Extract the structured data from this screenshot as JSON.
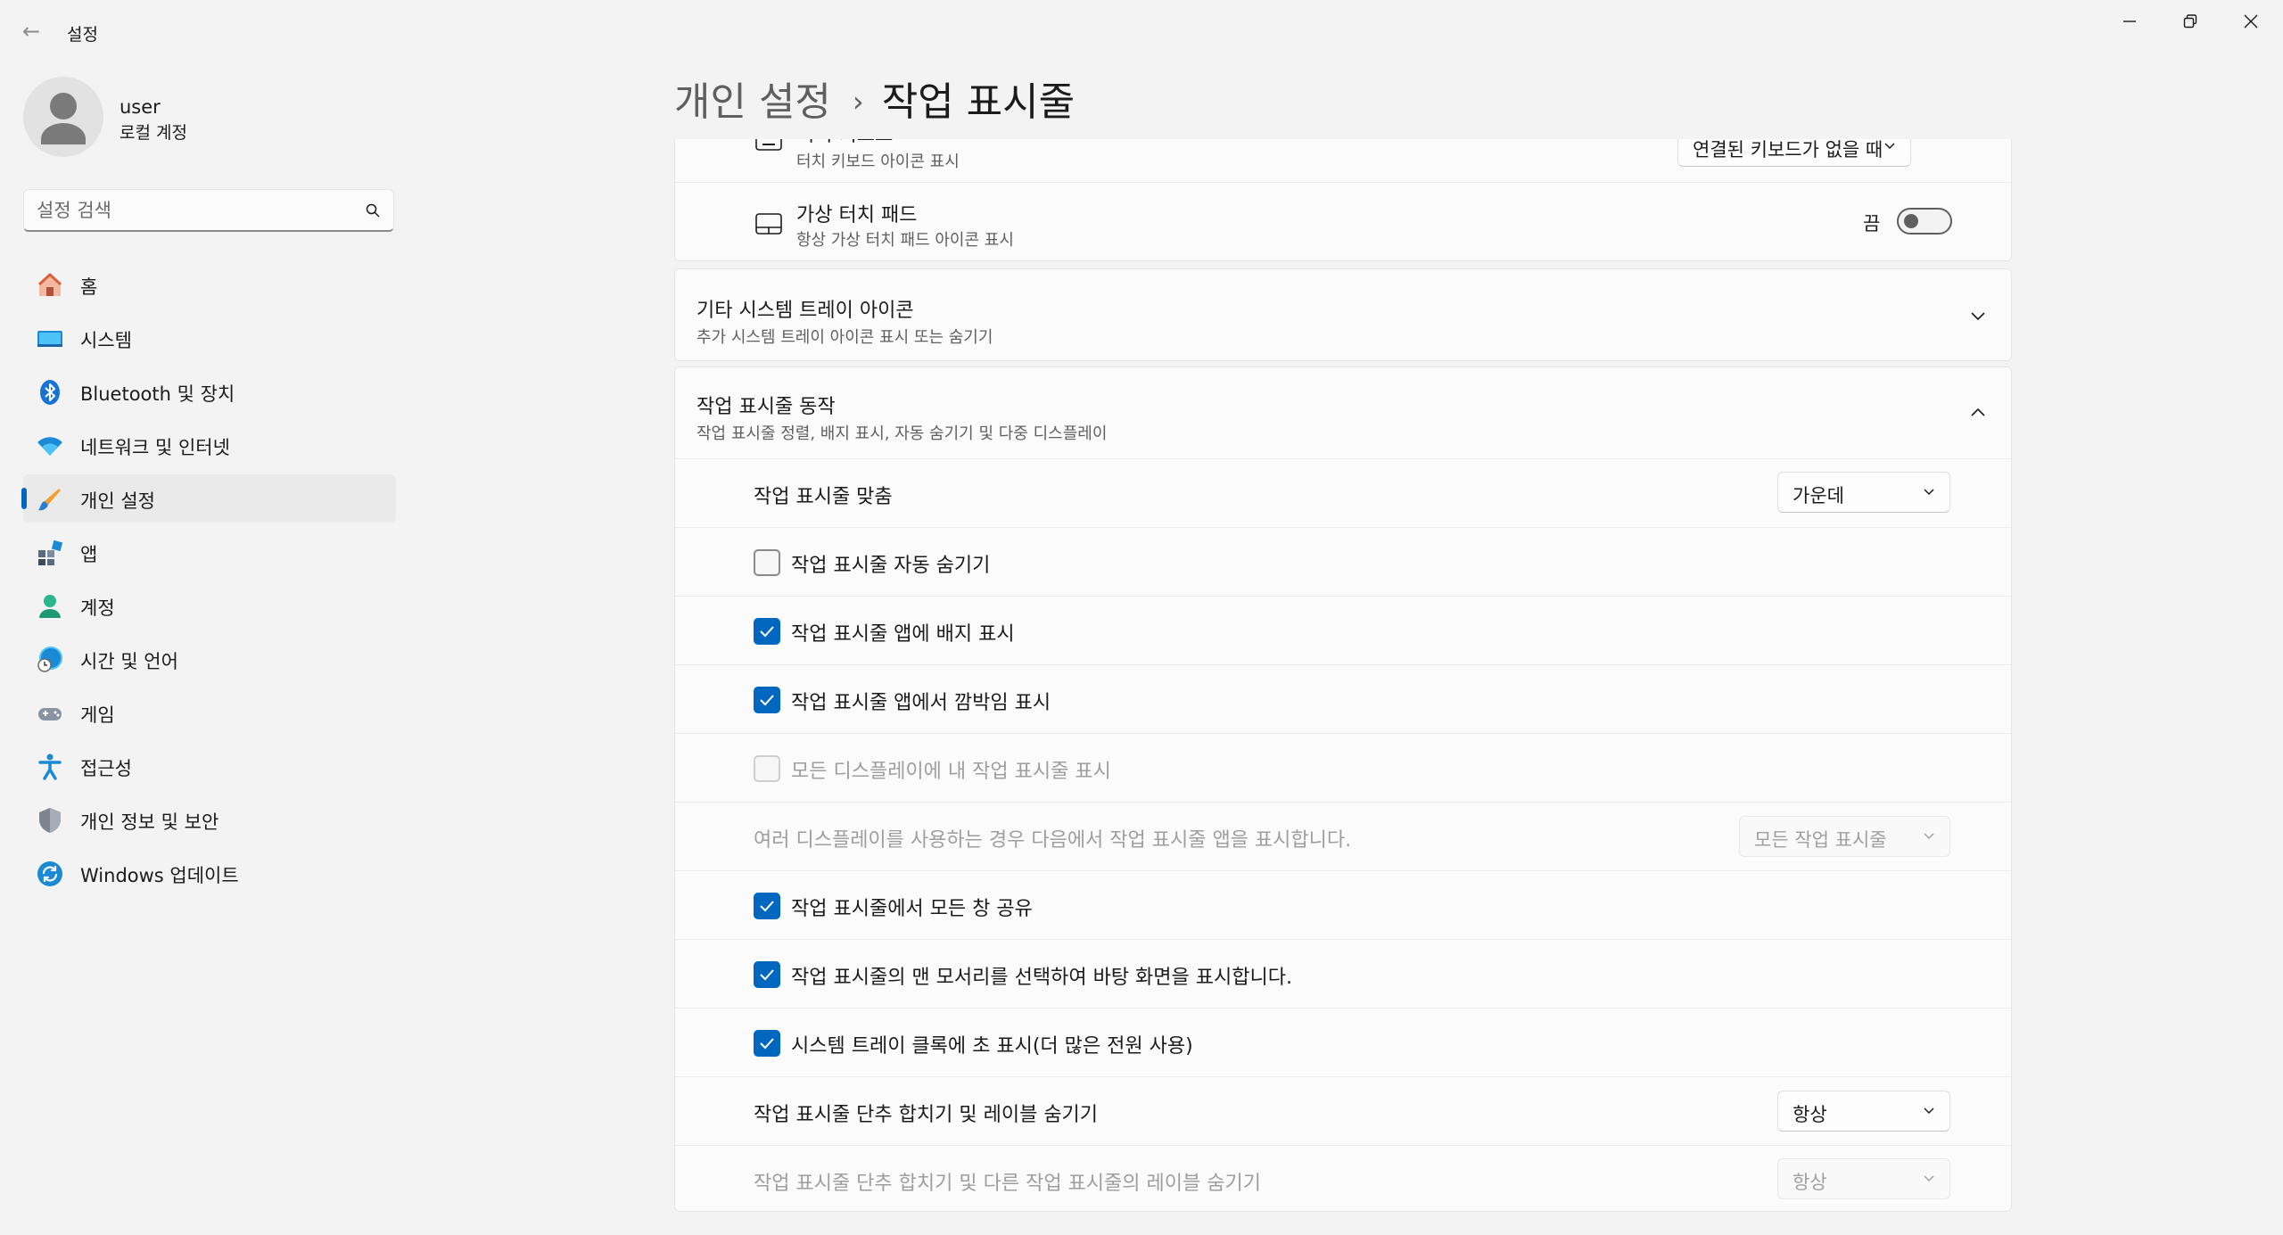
{
  "window": {
    "title": "설정",
    "back_glyph": "←"
  },
  "user": {
    "name": "user",
    "account_type": "로컬 계정"
  },
  "search": {
    "placeholder": "설정 검색"
  },
  "sidebar": {
    "items": [
      {
        "label": "홈",
        "icon": "home-icon",
        "active": false
      },
      {
        "label": "시스템",
        "icon": "system-icon",
        "active": false
      },
      {
        "label": "Bluetooth 및 장치",
        "icon": "bluetooth-icon",
        "active": false
      },
      {
        "label": "네트워크 및 인터넷",
        "icon": "wifi-icon",
        "active": false
      },
      {
        "label": "개인 설정",
        "icon": "brush-icon",
        "active": true
      },
      {
        "label": "앱",
        "icon": "apps-icon",
        "active": false
      },
      {
        "label": "계정",
        "icon": "account-icon",
        "active": false
      },
      {
        "label": "시간 및 언어",
        "icon": "globe-clock-icon",
        "active": false
      },
      {
        "label": "게임",
        "icon": "gamepad-icon",
        "active": false
      },
      {
        "label": "접근성",
        "icon": "accessibility-icon",
        "active": false
      },
      {
        "label": "개인 정보 및 보안",
        "icon": "shield-icon",
        "active": false
      },
      {
        "label": "Windows 업데이트",
        "icon": "update-icon",
        "active": false
      }
    ]
  },
  "header": {
    "parent": "개인 설정",
    "separator": "›",
    "current": "작업 표시줄"
  },
  "pen_section": {
    "touch_keyboard": {
      "title": "터치 키보드",
      "subtitle": "터치 키보드 아이콘 표시",
      "value": "연결된 키보드가 없을 때"
    },
    "touchpad": {
      "title": "가상 터치 패드",
      "subtitle": "항상 가상 터치 패드 아이콘 표시",
      "toggle_label": "끔",
      "toggle_on": false
    }
  },
  "other_tray": {
    "title": "기타 시스템 트레이 아이콘",
    "subtitle": "추가 시스템 트레이 아이콘 표시 또는 숨기기",
    "expanded": false
  },
  "behaviors": {
    "title": "작업 표시줄 동작",
    "subtitle": "작업 표시줄 정렬, 배지 표시, 자동 숨기기 및 다중 디스플레이",
    "expanded": true,
    "alignment": {
      "label": "작업 표시줄 맞춤",
      "value": "가운데"
    },
    "auto_hide": {
      "label": "작업 표시줄 자동 숨기기",
      "checked": false
    },
    "badges": {
      "label": "작업 표시줄 앱에 배지 표시",
      "checked": true
    },
    "flashing": {
      "label": "작업 표시줄 앱에서 깜박임 표시",
      "checked": true
    },
    "all_displays": {
      "label": "모든 디스플레이에 내 작업 표시줄 표시",
      "checked": false,
      "disabled": true
    },
    "multi_display": {
      "label": "여러 디스플레이를 사용하는 경우 다음에서 작업 표시줄 앱을 표시합니다.",
      "value": "모든 작업 표시줄",
      "disabled": true
    },
    "share_window": {
      "label": "작업 표시줄에서 모든 창 공유",
      "checked": true
    },
    "far_corner": {
      "label": "작업 표시줄의 맨 모서리를 선택하여 바탕 화면을 표시합니다.",
      "checked": true
    },
    "seconds": {
      "label": "시스템 트레이 클록에 초 표시(더 많은 전원 사용)",
      "checked": true
    },
    "combine": {
      "label": "작업 표시줄 단추 합치기 및 레이블 숨기기",
      "value": "항상"
    },
    "combine_other": {
      "label": "작업 표시줄 단추 합치기 및 다른 작업 표시줄의 레이블 숨기기",
      "value": "항상",
      "disabled": true
    }
  },
  "colors": {
    "accent": "#0067c0",
    "background": "#f3f3f3",
    "card": "#fbfbfb"
  }
}
